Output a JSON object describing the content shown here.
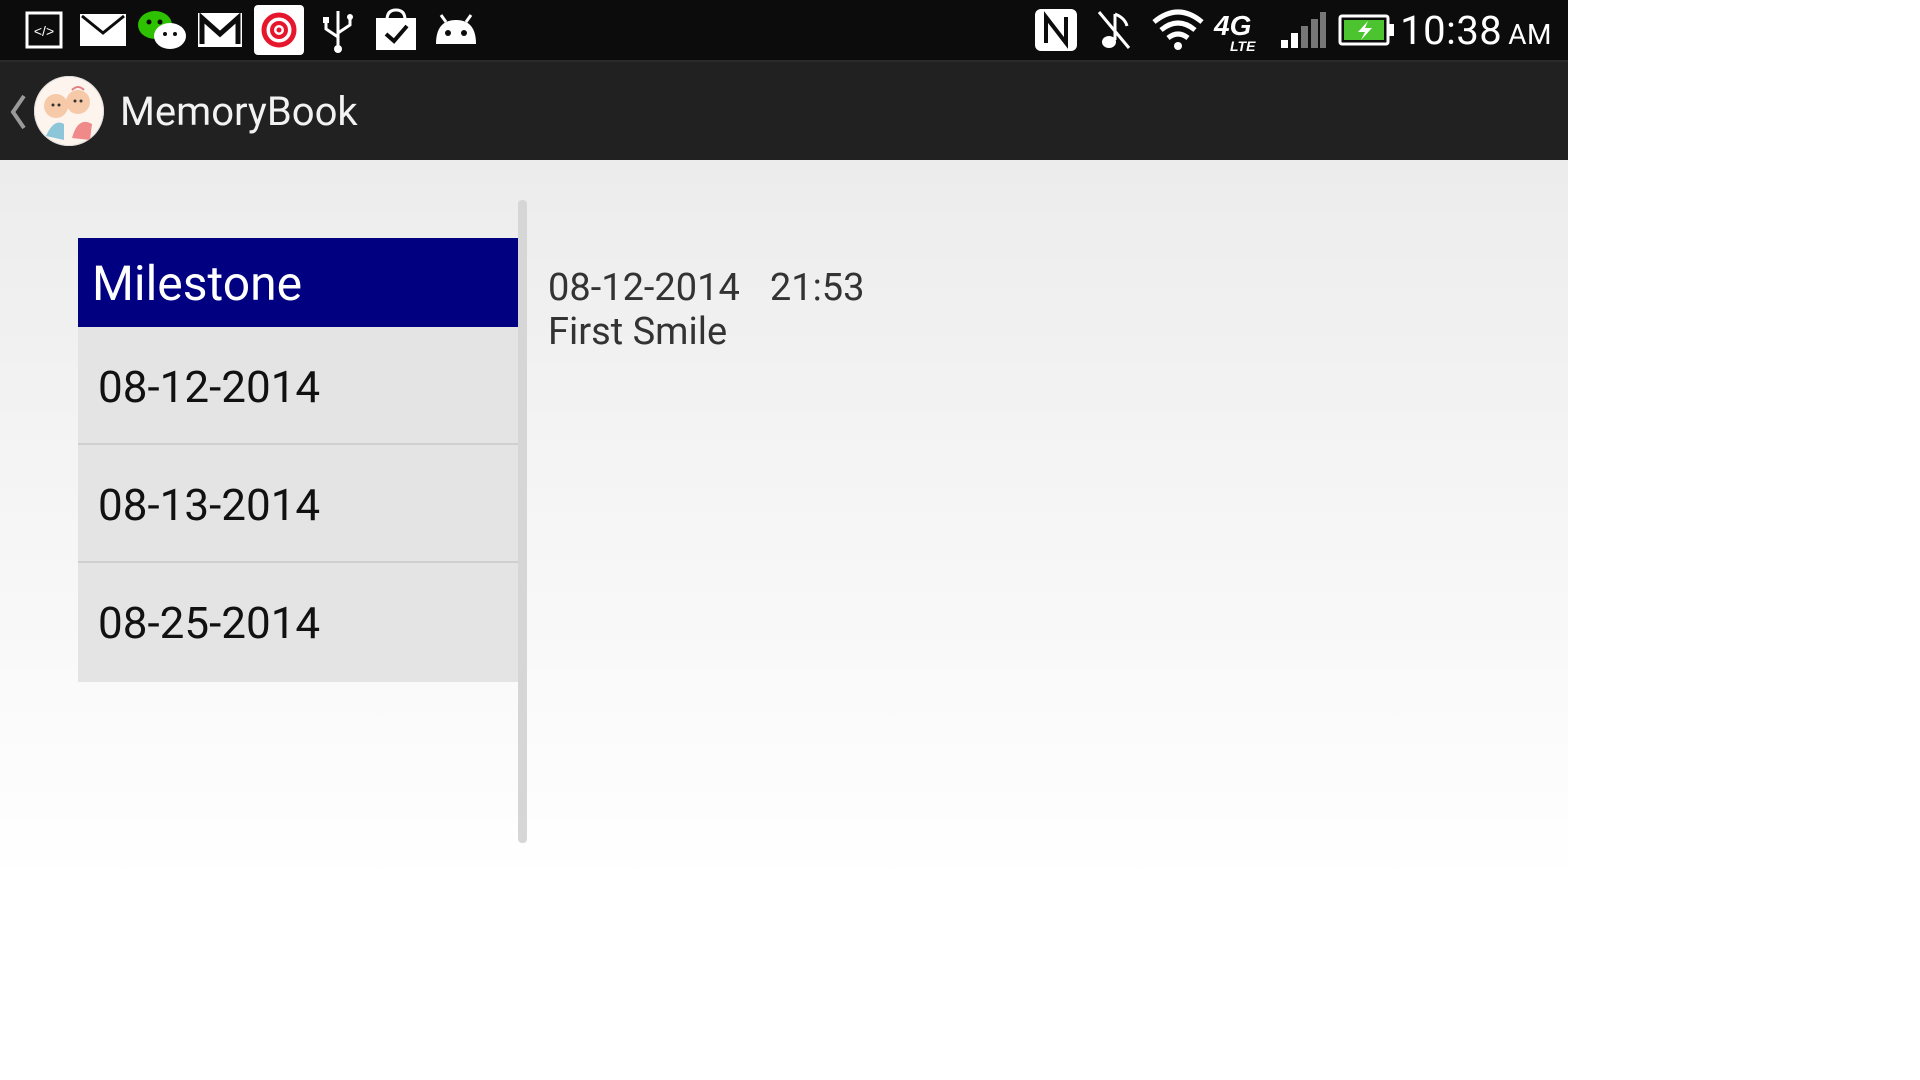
{
  "status_bar": {
    "left_icons": [
      "code-icon",
      "mail-icon",
      "wechat-icon",
      "gmail-icon",
      "weibo-icon",
      "usb-icon",
      "bag-check-icon",
      "android-icon"
    ],
    "right_icons": [
      "nfc-icon",
      "mute-icon",
      "wifi-icon",
      "lte-icon",
      "signal-icon",
      "battery-charging-icon"
    ],
    "time": "10:38",
    "ampm": "AM"
  },
  "action_bar": {
    "title": "MemoryBook"
  },
  "list": {
    "header": "Milestone",
    "items": [
      "08-12-2014",
      "08-13-2014",
      "08-25-2014"
    ]
  },
  "detail": {
    "date": "08-12-2014",
    "time": "21:53",
    "title": "First Smile"
  },
  "colors": {
    "header_bg": "#000080",
    "action_bar_bg": "#212121",
    "status_bar_bg": "#0c0c0c",
    "list_item_bg": "#e4e4e4"
  }
}
